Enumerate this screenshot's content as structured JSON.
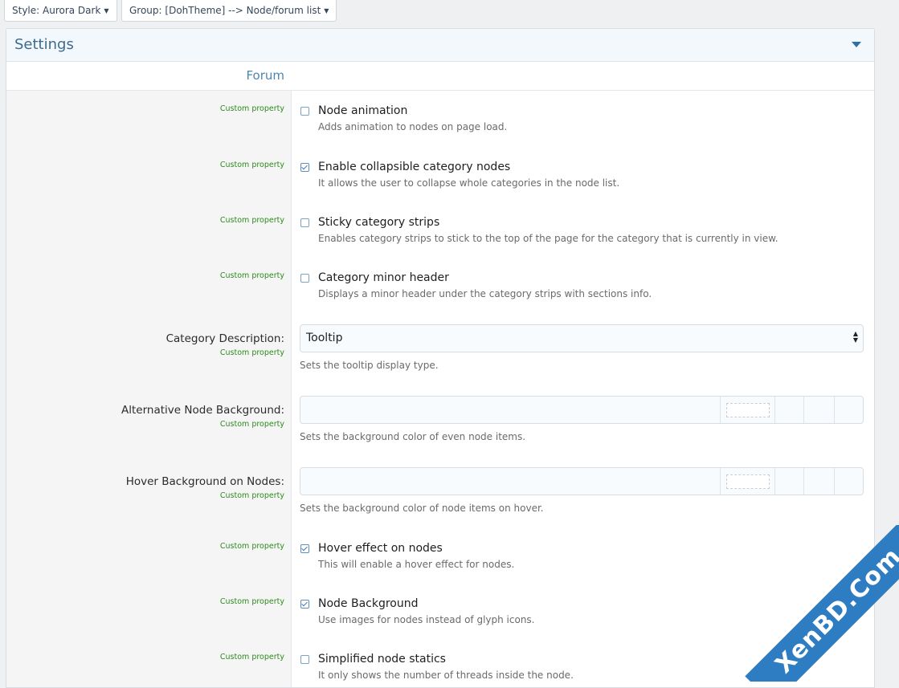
{
  "filters": {
    "style_label": "Style: Aurora Dark",
    "group_label": "Group: [DohTheme] --> Node/forum list"
  },
  "panel": {
    "title": "Settings",
    "group": "Forum"
  },
  "custom_tag": "Custom property",
  "options": [
    {
      "title": "Node animation",
      "desc": "Adds animation to nodes on page load.",
      "checked": false
    },
    {
      "title": "Enable collapsible category nodes",
      "desc": "It allows the user to collapse whole categories in the node list.",
      "checked": true
    },
    {
      "title": "Sticky category strips",
      "desc": "Enables category strips to stick to the top of the page for the category that is currently in view.",
      "checked": false
    },
    {
      "title": "Category minor header",
      "desc": "Displays a minor header under the category strips with sections info.",
      "checked": false
    }
  ],
  "category_description": {
    "label": "Category Description:",
    "value": "Tooltip",
    "desc": "Sets the tooltip display type."
  },
  "alt_node_bg": {
    "label": "Alternative Node Background:",
    "desc": "Sets the background color of even node items."
  },
  "hover_bg": {
    "label": "Hover Background on Nodes:",
    "desc": "Sets the background color of node items on hover."
  },
  "options2": [
    {
      "title": "Hover effect on nodes",
      "desc": "This will enable a hover effect for nodes.",
      "checked": true
    },
    {
      "title": "Node Background",
      "desc": "Use images for nodes instead of glyph icons.",
      "checked": true
    },
    {
      "title": "Simplified node statics",
      "desc": "It only shows the number of threads inside the node.",
      "checked": false
    }
  ],
  "watermark": "XenBD.Com"
}
